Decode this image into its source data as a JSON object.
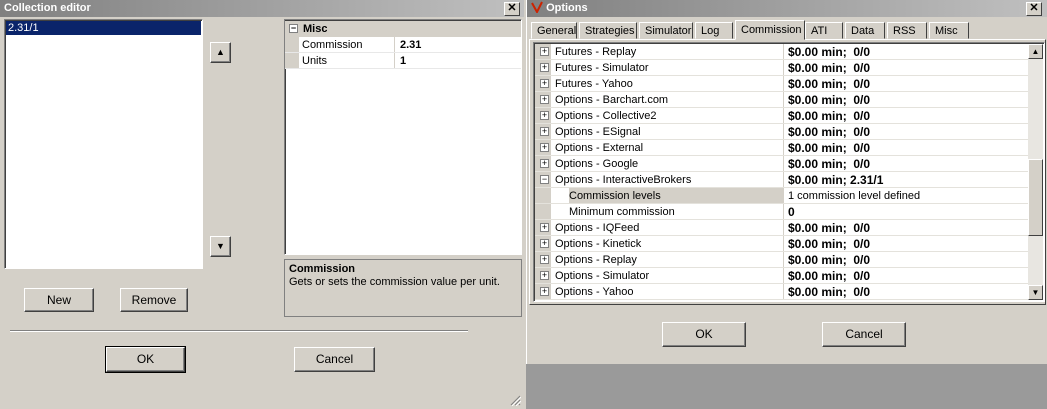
{
  "collection_editor": {
    "title": "Collection editor",
    "list_items": [
      "2.31/1"
    ],
    "up_arrow": "▲",
    "down_arrow": "▼",
    "property_group": "Misc",
    "properties": [
      {
        "name": "Commission",
        "value": "2.31"
      },
      {
        "name": "Units",
        "value": "1"
      }
    ],
    "description_title": "Commission",
    "description_text": "Gets or sets the commission value per unit.",
    "new_label": "New",
    "remove_label": "Remove",
    "ok_label": "OK",
    "cancel_label": "Cancel"
  },
  "options": {
    "title": "Options",
    "tabs": [
      "General",
      "Strategies",
      "Simulator",
      "Log",
      "Commission",
      "ATI",
      "Data",
      "RSS",
      "Misc"
    ],
    "active_tab": "Commission",
    "rows": [
      {
        "expander": "+",
        "name": "Futures - Replay",
        "value": "$0.00 min;  0/0"
      },
      {
        "expander": "+",
        "name": "Futures - Simulator",
        "value": "$0.00 min;  0/0"
      },
      {
        "expander": "+",
        "name": "Futures - Yahoo",
        "value": "$0.00 min;  0/0"
      },
      {
        "expander": "+",
        "name": "Options - Barchart.com",
        "value": "$0.00 min;  0/0"
      },
      {
        "expander": "+",
        "name": "Options - Collective2",
        "value": "$0.00 min;  0/0"
      },
      {
        "expander": "+",
        "name": "Options - ESignal",
        "value": "$0.00 min;  0/0"
      },
      {
        "expander": "+",
        "name": "Options - External",
        "value": "$0.00 min;  0/0"
      },
      {
        "expander": "+",
        "name": "Options - Google",
        "value": "$0.00 min;  0/0"
      },
      {
        "expander": "−",
        "name": "Options - InteractiveBrokers",
        "value": "$0.00 min; 2.31/1"
      },
      {
        "child": true,
        "name": "Commission levels",
        "value": "1 commission level defined"
      },
      {
        "child": true,
        "name": "Minimum commission",
        "value": "0"
      },
      {
        "expander": "+",
        "name": "Options - IQFeed",
        "value": "$0.00 min;  0/0"
      },
      {
        "expander": "+",
        "name": "Options - Kinetick",
        "value": "$0.00 min;  0/0"
      },
      {
        "expander": "+",
        "name": "Options - Replay",
        "value": "$0.00 min;  0/0"
      },
      {
        "expander": "+",
        "name": "Options - Simulator",
        "value": "$0.00 min;  0/0"
      },
      {
        "expander": "+",
        "name": "Options - Yahoo",
        "value": "$0.00 min;  0/0"
      }
    ],
    "ok_label": "OK",
    "cancel_label": "Cancel"
  },
  "close_glyph": "✕",
  "colors": {
    "selection": "#0a246a",
    "title_gradient_start": "#808080",
    "logo": "#cc2200"
  }
}
